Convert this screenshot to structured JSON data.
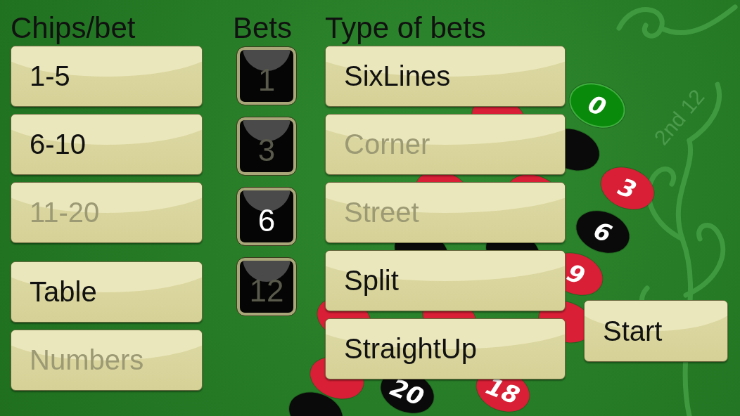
{
  "headers": {
    "chips_per_bet": "Chips/bet",
    "bets": "Bets",
    "type_of_bets": "Type of bets"
  },
  "chips_per_bet": [
    {
      "label": "1-5",
      "selected": true
    },
    {
      "label": "6-10",
      "selected": true
    },
    {
      "label": "11-20",
      "selected": false
    }
  ],
  "mode": [
    {
      "label": "Table",
      "selected": true
    },
    {
      "label": "Numbers",
      "selected": false
    }
  ],
  "bets": [
    {
      "label": "1",
      "selected": false
    },
    {
      "label": "3",
      "selected": false
    },
    {
      "label": "6",
      "selected": true
    },
    {
      "label": "12",
      "selected": false
    }
  ],
  "bet_types": [
    {
      "label": "SixLines",
      "selected": true
    },
    {
      "label": "Corner",
      "selected": false
    },
    {
      "label": "Street",
      "selected": false
    },
    {
      "label": "Split",
      "selected": true
    },
    {
      "label": "StraightUp",
      "selected": true
    }
  ],
  "start_button": "Start",
  "table_label": "2nd 12",
  "table_chips": [
    {
      "label": "0",
      "color": "#0a8a0a"
    },
    {
      "label": "3",
      "color": "#d81f35"
    },
    {
      "label": "6",
      "color": "#0a0a0a"
    },
    {
      "label": "9",
      "color": "#d81f35"
    },
    {
      "label": "18",
      "color": "#d81f35"
    },
    {
      "label": "20",
      "color": "#0a0a0a"
    }
  ]
}
